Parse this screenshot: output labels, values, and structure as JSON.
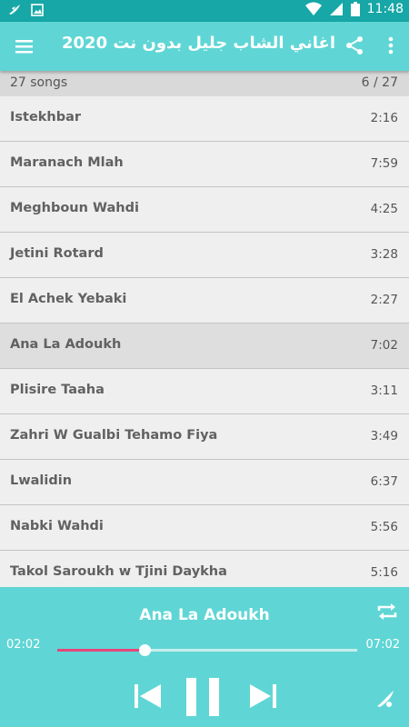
{
  "status_bar": {
    "time": "11:48",
    "icons": [
      "app-logo-icon",
      "image-icon",
      "wifi-icon",
      "signal-icon",
      "battery-icon"
    ]
  },
  "app_bar": {
    "title": "اغاني الشاب جليل بدون نت 2020",
    "icons": [
      "menu-icon",
      "share-icon",
      "more-vert-icon"
    ]
  },
  "summary": {
    "count": "27 songs",
    "position": "6 / 27"
  },
  "songs": [
    {
      "title": "Istekhbar",
      "duration": "2:16"
    },
    {
      "title": "Maranach Mlah",
      "duration": "7:59"
    },
    {
      "title": "Meghboun Wahdi",
      "duration": "4:25"
    },
    {
      "title": "Jetini Rotard",
      "duration": "3:28"
    },
    {
      "title": "El Achek Yebaki",
      "duration": "2:27"
    },
    {
      "title": "Ana La Adoukh",
      "duration": "7:02"
    },
    {
      "title": "Plisire Taaha",
      "duration": "3:11"
    },
    {
      "title": "Zahri W Gualbi Tehamo Fiya",
      "duration": "3:49"
    },
    {
      "title": "Lwalidin",
      "duration": "6:37"
    },
    {
      "title": "Nabki Wahdi",
      "duration": "5:56"
    },
    {
      "title": "Takol Saroukh w Tjini Daykha",
      "duration": "5:16"
    }
  ],
  "player": {
    "now_playing": "Ana La Adoukh",
    "current_time": "02:02",
    "total_time": "07:02",
    "progress": 0.29,
    "icons": [
      "repeat-icon",
      "skip-previous-icon",
      "pause-icon",
      "skip-next-icon",
      "app-logo-icon"
    ]
  },
  "colors": {
    "status_bar": "#16a7a6",
    "app_bar": "#5fd6d5",
    "summary_bar": "#d9d9d9",
    "list_bg": "#efefef",
    "active_row": "#dedede",
    "seek_fill": "#e4467a"
  }
}
